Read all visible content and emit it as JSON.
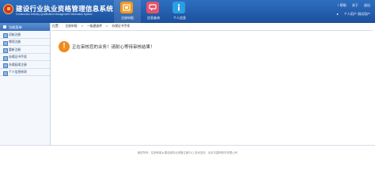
{
  "header": {
    "title": "建设行业执业资格管理信息系统",
    "subtitle": "Construction Industry Qualification Management Information System",
    "nav": [
      {
        "label": "注册申报",
        "icon": "register-icon",
        "color": "#f39a1e"
      },
      {
        "label": "信息查询",
        "icon": "message-icon",
        "color": "#e8516a"
      },
      {
        "label": "个人信息",
        "icon": "info-icon",
        "color": "#2a9fe3"
      }
    ],
    "help": "? 帮助",
    "about": "关于",
    "logout": "退出",
    "user": "个人用户 测试用户"
  },
  "sidebar": {
    "title": "功能菜单",
    "items": [
      {
        "label": "初始注册"
      },
      {
        "label": "增项注册"
      },
      {
        "label": "重新注册"
      },
      {
        "label": "办理证书手续"
      },
      {
        "label": "办理延续注册"
      },
      {
        "label": "个人信息修改"
      }
    ]
  },
  "breadcrumb": {
    "prefix": "位置：",
    "items": [
      "注册申报",
      "一级建造师",
      "办理证书手续"
    ]
  },
  "main": {
    "message": "正在审核您的业务！请耐心等待审核结果！"
  },
  "footer": {
    "text": "版权所有：住房和城乡建设部执业资格注册中心    技术支持：北京中建研软件有限公司"
  }
}
